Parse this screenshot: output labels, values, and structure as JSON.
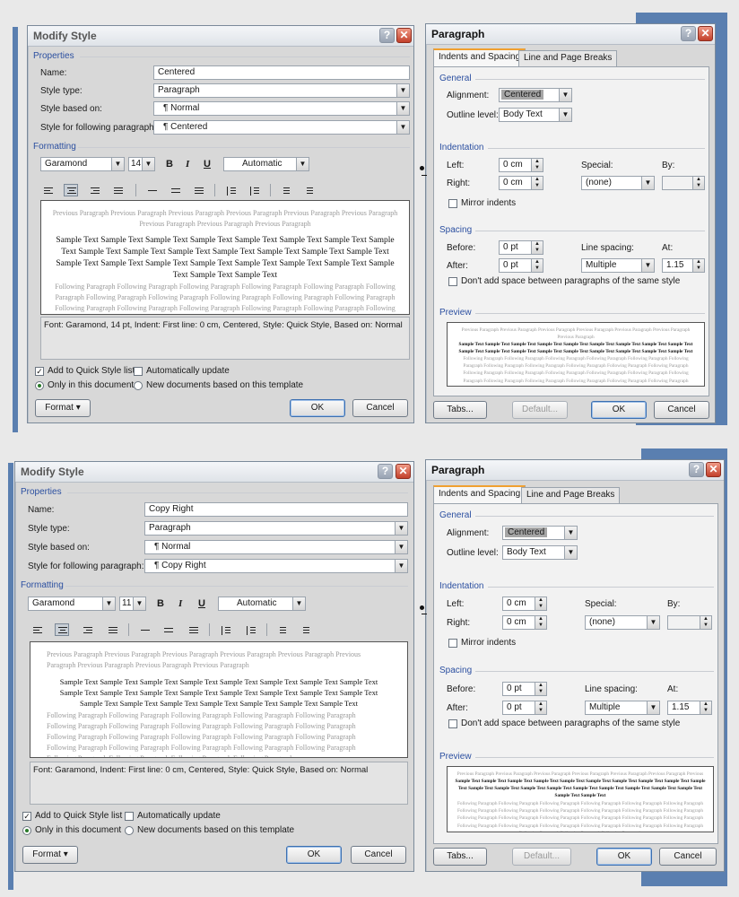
{
  "top": {
    "modify": {
      "title": "Modify Style",
      "properties_label": "Properties",
      "name_label": "Name:",
      "name_value": "Centered",
      "style_type_label": "Style type:",
      "style_type_value": "Paragraph",
      "based_on_label": "Style based on:",
      "based_on_value": "¶  Normal",
      "following_label": "Style for following paragraph:",
      "following_value": "¶  Centered",
      "formatting_label": "Formatting",
      "font": "Garamond",
      "size": "14",
      "color": "Automatic",
      "preview_prev": "Previous Paragraph Previous Paragraph Previous Paragraph Previous Paragraph Previous Paragraph Previous Paragraph Previous Paragraph Previous Paragraph Previous Paragraph",
      "preview_sample": "Sample Text Sample Text Sample Text Sample Text Sample Text Sample Text Sample Text Sample Text Sample Text Sample Text Sample Text Sample Text Sample Text Sample Text Sample Text Sample Text Sample Text Sample Text Sample Text Sample Text Sample Text Sample Text Sample Text Sample Text Sample Text",
      "preview_following": "Following Paragraph Following Paragraph Following Paragraph Following Paragraph Following Paragraph Following Paragraph Following Paragraph Following Paragraph Following Paragraph Following Paragraph Following Paragraph Following Paragraph Following Paragraph Following Paragraph Following Paragraph Following Paragraph Following Paragraph Following Paragraph",
      "description": "Font: Garamond, 14 pt, Indent: First line:  0 cm, Centered, Style: Quick Style, Based on: Normal",
      "add_quick": "Add to Quick Style list",
      "auto_update": "Automatically update",
      "only_doc": "Only in this document",
      "new_docs": "New documents based on this template",
      "format_btn": "Format ▾",
      "ok": "OK",
      "cancel": "Cancel"
    },
    "para": {
      "title": "Paragraph",
      "tab1": "Indents and Spacing",
      "tab2": "Line and Page Breaks",
      "general": "General",
      "alignment_label": "Alignment:",
      "alignment_value": "Centered",
      "outline_label": "Outline level:",
      "outline_value": "Body Text",
      "indentation": "Indentation",
      "left_label": "Left:",
      "left_value": "0 cm",
      "right_label": "Right:",
      "right_value": "0 cm",
      "special_label": "Special:",
      "special_value": "(none)",
      "by_label": "By:",
      "mirror": "Mirror indents",
      "spacing": "Spacing",
      "before_label": "Before:",
      "before_value": "0 pt",
      "after_label": "After:",
      "after_value": "0 pt",
      "line_spacing_label": "Line spacing:",
      "line_spacing_value": "Multiple",
      "at_label": "At:",
      "at_value": "1.15",
      "dont_add": "Don't add space between paragraphs of the same style",
      "preview": "Preview",
      "pv_prev": "Previous Paragraph Previous Paragraph Previous Paragraph Previous Paragraph Previous Paragraph Previous Paragraph Previous Paragraph",
      "pv_sample": "Sample Text Sample Text Sample Text Sample Text Sample Text Sample Text Sample Text Sample Text Sample Text Sample Text Sample Text Sample Text Sample Text Sample Text Sample Text Sample Text Sample Text Sample Text Sample Text Sample Text Sample Text",
      "pv_follow": "Following Paragraph Following Paragraph Following Paragraph Following Paragraph Following Paragraph Following Paragraph Following Paragraph Following Paragraph Following Paragraph Following Paragraph Following Paragraph Following Paragraph Following Paragraph Following Paragraph Following Paragraph Following Paragraph Following Paragraph Following Paragraph Following Paragraph Following Paragraph Following Paragraph Following Paragraph Following Paragraph Following Paragraph Following Paragraph Following Paragraph Following Paragraph",
      "tabs_btn": "Tabs...",
      "default_btn": "Default...",
      "ok": "OK",
      "cancel": "Cancel"
    }
  },
  "bottom": {
    "modify": {
      "title": "Modify Style",
      "properties_label": "Properties",
      "name_label": "Name:",
      "name_value": "Copy Right",
      "style_type_label": "Style type:",
      "style_type_value": "Paragraph",
      "based_on_label": "Style based on:",
      "based_on_value": "¶  Normal",
      "following_label": "Style for following paragraph:",
      "following_value": "¶  Copy Right",
      "formatting_label": "Formatting",
      "font": "Garamond",
      "size": "11",
      "color": "Automatic",
      "preview_prev": "Previous Paragraph Previous Paragraph Previous Paragraph Previous Paragraph Previous Paragraph Previous Paragraph Previous Paragraph Previous Paragraph Previous Paragraph",
      "preview_sample": "Sample Text Sample Text Sample Text Sample Text Sample Text Sample Text Sample Text Sample Text Sample Text Sample Text Sample Text Sample Text Sample Text Sample Text Sample Text Sample Text Sample Text Sample Text Sample Text Sample Text Sample Text Sample Text Sample Text",
      "preview_following": "Following Paragraph Following Paragraph Following Paragraph Following Paragraph Following Paragraph Following Paragraph Following Paragraph Following Paragraph Following Paragraph Following Paragraph Following Paragraph Following Paragraph Following Paragraph Following Paragraph Following Paragraph Following Paragraph Following Paragraph Following Paragraph Following Paragraph Following Paragraph Following Paragraph Following Paragraph Following Paragraph Following Paragraph",
      "description": "Font: Garamond, Indent: First line:  0 cm, Centered, Style: Quick Style, Based on: Normal",
      "add_quick": "Add to Quick Style list",
      "auto_update": "Automatically update",
      "only_doc": "Only in this document",
      "new_docs": "New documents based on this template",
      "format_btn": "Format ▾",
      "ok": "OK",
      "cancel": "Cancel"
    },
    "para": {
      "title": "Paragraph",
      "tab1": "Indents and Spacing",
      "tab2": "Line and Page Breaks",
      "general": "General",
      "alignment_label": "Alignment:",
      "alignment_value": "Centered",
      "outline_label": "Outline level:",
      "outline_value": "Body Text",
      "indentation": "Indentation",
      "left_label": "Left:",
      "left_value": "0 cm",
      "right_label": "Right:",
      "right_value": "0 cm",
      "special_label": "Special:",
      "special_value": "(none)",
      "by_label": "By:",
      "mirror": "Mirror indents",
      "spacing": "Spacing",
      "before_label": "Before:",
      "before_value": "0 pt",
      "after_label": "After:",
      "after_value": "0 pt",
      "line_spacing_label": "Line spacing:",
      "line_spacing_value": "Multiple",
      "at_label": "At:",
      "at_value": "1.15",
      "dont_add": "Don't add space between paragraphs of the same style",
      "preview": "Preview",
      "pv_prev": "Previous Paragraph Previous Paragraph Previous Paragraph Previous Paragraph Previous Paragraph Previous Paragraph Previous Paragraph",
      "pv_sample": "Sample Text Sample Text Sample Text Sample Text Sample Text Sample Text Sample Text Sample Text Sample Text Sample Text Sample Text Sample Text Sample Text Sample Text Sample Text Sample Text Sample Text Sample Text Sample Text Sample Text Sample Text",
      "pv_follow": "Following Paragraph Following Paragraph Following Paragraph Following Paragraph Following Paragraph Following Paragraph Following Paragraph Following Paragraph Following Paragraph Following Paragraph Following Paragraph Following Paragraph Following Paragraph Following Paragraph Following Paragraph Following Paragraph Following Paragraph Following Paragraph Following Paragraph Following Paragraph Following Paragraph Following Paragraph Following Paragraph Following Paragraph Following Paragraph Following Paragraph Following Paragraph",
      "tabs_btn": "Tabs...",
      "default_btn": "Default...",
      "ok": "OK",
      "cancel": "Cancel"
    }
  },
  "colors": {
    "section_label": "#2b4fa0",
    "accent_blue": "#5a7fb0",
    "tab_highlight": "#f0a030",
    "close_red": "#c2402b"
  }
}
